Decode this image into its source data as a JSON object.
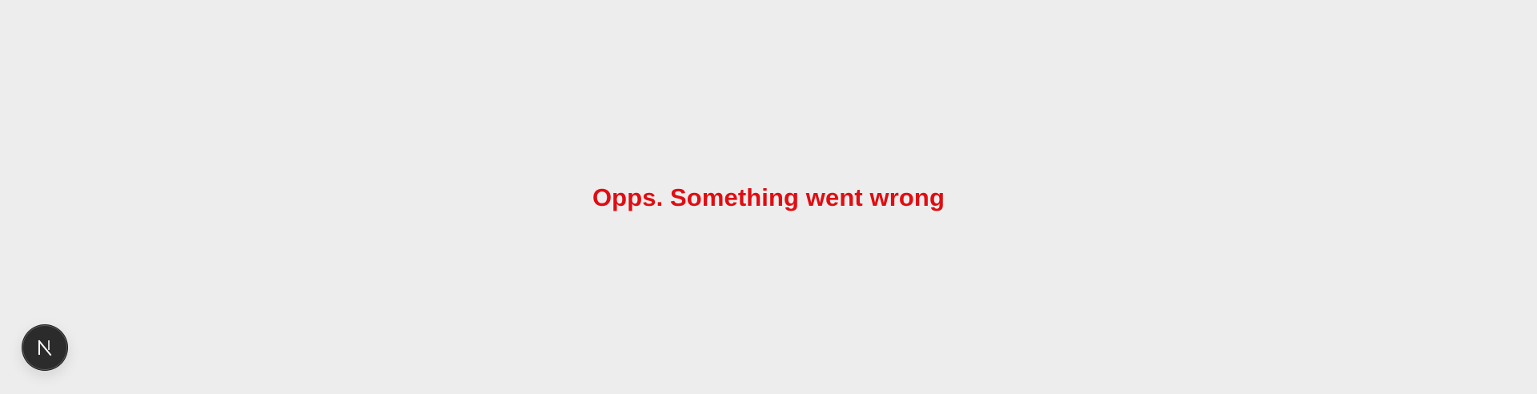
{
  "error": {
    "message": "Opps. Something went wrong",
    "color": "#e00d12"
  },
  "dev_indicator": {
    "icon": "nextjs-logo-icon",
    "background": "#2b2b2b"
  },
  "page": {
    "background": "#ededed"
  }
}
